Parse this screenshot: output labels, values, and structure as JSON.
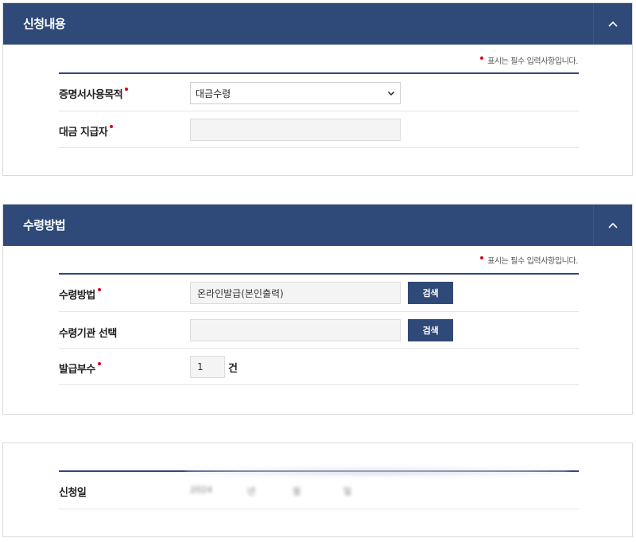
{
  "application_section": {
    "title": "신청내용",
    "required_note": "표시는 필수 입력사항입니다.",
    "purpose": {
      "label": "증명서사용목적",
      "selected": "대금수령"
    },
    "payer": {
      "label": "대금 지급자",
      "value": ""
    }
  },
  "receipt_section": {
    "title": "수령방법",
    "required_note": "표시는 필수 입력사항입니다.",
    "method": {
      "label": "수령방법",
      "value": "온라인발급(본인출력)",
      "search_label": "검색"
    },
    "agency": {
      "label": "수령기관 선택",
      "value": "",
      "search_label": "검색"
    },
    "copies": {
      "label": "발급부수",
      "value": "1",
      "unit": "건"
    }
  },
  "date_section": {
    "label": "신청일",
    "date_parts": [
      "2024",
      "년",
      "월",
      "일"
    ]
  },
  "colors": {
    "header_bg": "#2f4a78",
    "required_dot": "#d8001e",
    "input_bg": "#f4f4f4"
  },
  "icons": {
    "collapse": "chevron-up-icon",
    "select_arrow": "chevron-down-icon"
  }
}
